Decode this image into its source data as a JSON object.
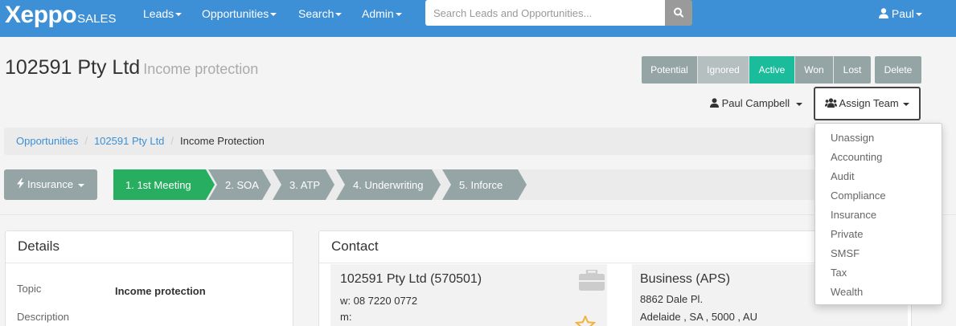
{
  "colors": {
    "nav": "#3d8fd6",
    "accent": "#1abc9c",
    "grey": "#95a5a6"
  },
  "navbar": {
    "brand_main": "Xeppo",
    "brand_sub": "SALES",
    "items": [
      {
        "label": "Leads"
      },
      {
        "label": "Opportunities"
      },
      {
        "label": "Search"
      },
      {
        "label": "Admin"
      }
    ],
    "search_placeholder": "Search Leads and Opportunities...",
    "user": "Paul"
  },
  "header": {
    "title": "102591 Pty Ltd",
    "subtitle": "Income protection",
    "statuses": [
      {
        "label": "Potential"
      },
      {
        "label": "Ignored"
      },
      {
        "label": "Active"
      },
      {
        "label": "Won"
      },
      {
        "label": "Lost"
      }
    ],
    "selected_status": "Active",
    "delete_label": "Delete",
    "owner": "Paul Campbell",
    "assign_label": "Assign Team"
  },
  "breadcrumb": [
    "Opportunities",
    "102591 Pty Ltd",
    "Income Protection"
  ],
  "pipeline": {
    "category": "Insurance",
    "stages": [
      "1. 1st Meeting",
      "2. SOA",
      "3. ATP",
      "4. Underwriting",
      "5. Inforce"
    ],
    "current": "1. 1st Meeting"
  },
  "details": {
    "title": "Details",
    "topic_label": "Topic",
    "topic_value": "Income protection",
    "description_label": "Description"
  },
  "contact": {
    "title": "Contact",
    "name": "102591 Pty Ltd (570501)",
    "work": "w: 08 7220 0772",
    "mobile": "m:",
    "business": "Business (APS)",
    "address1": "8862 Dale Pl.",
    "address2": "Adelaide , SA , 5000 , AU"
  },
  "assign_menu": [
    "Unassign",
    "Accounting",
    "Audit",
    "Compliance",
    "Insurance",
    "Private",
    "SMSF",
    "Tax",
    "Wealth"
  ]
}
